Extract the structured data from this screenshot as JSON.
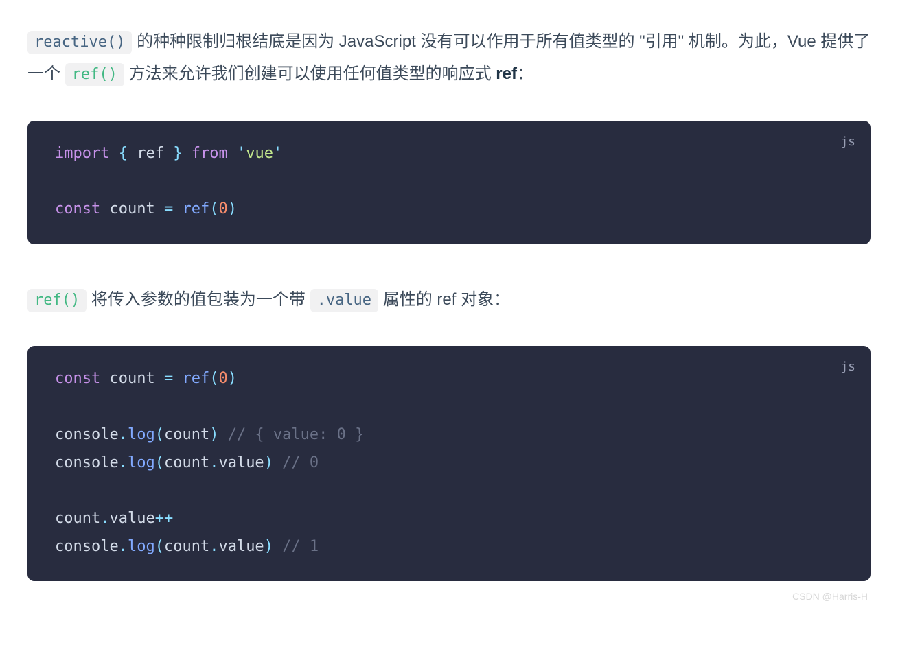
{
  "para1": {
    "code_reactive": "reactive()",
    "t1": " 的种种限制归根结底是因为 JavaScript 没有可以作用于所有值类型的 \"引用\" 机制。为此，Vue 提供了一个 ",
    "code_ref": "ref()",
    "t2": " 方法来允许我们创建可以使用任何值类型的响应式 ",
    "bold_ref": "ref",
    "t3": "："
  },
  "block1": {
    "lang": "js",
    "tokens": {
      "import": "import",
      "lbrace": " { ",
      "ref": "ref",
      "rbrace": " } ",
      "from": "from",
      "sp": " ",
      "q1": "'",
      "vue": "vue",
      "q2": "'",
      "const": "const",
      "count": " count ",
      "eq": "=",
      "reffn": " ref",
      "lp": "(",
      "zero": "0",
      "rp": ")"
    }
  },
  "para2": {
    "code_ref": "ref()",
    "t1": " 将传入参数的值包装为一个带 ",
    "code_value": ".value",
    "t2": " 属性的 ref 对象："
  },
  "block2": {
    "lang": "js",
    "tokens": {
      "const": "const",
      "count": " count ",
      "eq": "=",
      "reffn": " ref",
      "lp": "(",
      "zero": "0",
      "rp": ")",
      "console": "console",
      "dot": ".",
      "log": "log",
      "lp2": "(",
      "countv": "count",
      "rp2": ")",
      "c_obj": " // { value: 0 }",
      "value": "value",
      "c_zero": " // 0",
      "pp": "++",
      "c_one": " // 1"
    }
  },
  "watermark": "CSDN @Harris-H"
}
